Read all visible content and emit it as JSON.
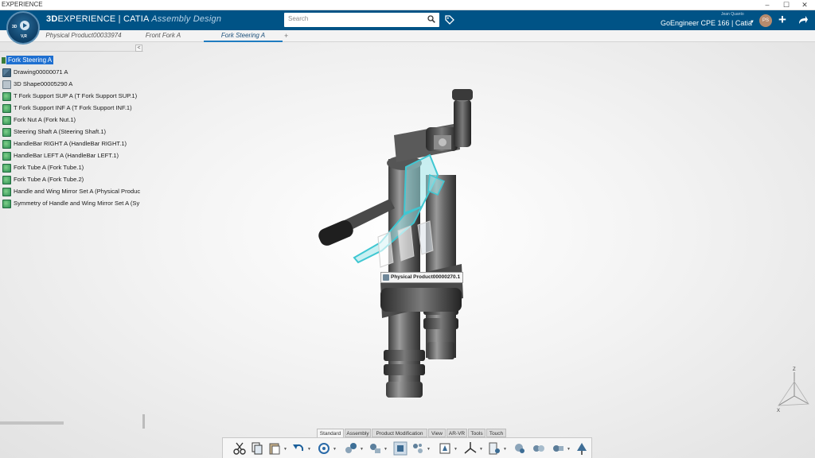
{
  "os": {
    "title": "EXPERIENCE",
    "minimize": "–",
    "maximize": "☐",
    "close": "✕"
  },
  "header": {
    "compass_3d": "3D",
    "compass_version": "V,R",
    "brand_strong": "3D",
    "brand_text": "EXPERIENCE | CATIA",
    "app_name": "Assembly Design",
    "search_placeholder": "Search",
    "user_name": "Jean Quanto",
    "tenant": "GoEngineer CPE 166 | Catia",
    "avatar_initials": "PS",
    "add_glyph": "+"
  },
  "tabs": [
    {
      "label": "Physical Product00033974"
    },
    {
      "label": "Front Fork A"
    },
    {
      "label": "Fork Steering A"
    }
  ],
  "tab_add": "+",
  "tree": {
    "collapse_glyph": "<",
    "root": "Fork Steering A",
    "items": [
      {
        "label": "Drawing00000071 A",
        "icon": "drawing-icon"
      },
      {
        "label": "3D Shape00005290 A",
        "icon": "shape-icon"
      },
      {
        "label": "T Fork Support SUP A (T Fork Support SUP.1)",
        "icon": "part-icon"
      },
      {
        "label": "T Fork Support INF A (T Fork Support INF.1)",
        "icon": "part-icon"
      },
      {
        "label": "Fork Nut A (Fork Nut.1)",
        "icon": "part-icon"
      },
      {
        "label": "Steering Shaft A (Steering Shaft.1)",
        "icon": "part-icon"
      },
      {
        "label": "HandleBar RIGHT A (HandleBar RIGHT.1)",
        "icon": "part-icon"
      },
      {
        "label": "HandleBar LEFT A (HandleBar LEFT.1)",
        "icon": "part-icon"
      },
      {
        "label": "Fork Tube A (Fork Tube.1)",
        "icon": "part-icon"
      },
      {
        "label": "Fork Tube A (Fork Tube.2)",
        "icon": "part-icon"
      },
      {
        "label": "Handle and Wing Mirror Set A (Physical Produc",
        "icon": "part-icon"
      },
      {
        "label": "Symmetry of Handle and Wing Mirror Set A (Sy",
        "icon": "part-icon"
      }
    ]
  },
  "viewport": {
    "selection_label": "Physical Product00000270.1",
    "axis_z": "Z",
    "axis_x": "X"
  },
  "action_bar": {
    "sections": [
      "Standard",
      "Assembly",
      "Product Modification",
      "View",
      "AR-VR",
      "Tools",
      "Touch"
    ],
    "active_section": "Standard",
    "tools": [
      "cut-icon",
      "copy-icon",
      "paste-icon",
      "undo-icon",
      "update-icon",
      "snap-icon",
      "engineering-connection-icon",
      "fix-icon",
      "explode-icon",
      "manipulate-icon",
      "compass-icon",
      "filter-icon",
      "measure-icon",
      "section-icon",
      "clash-icon",
      "publish-icon"
    ]
  },
  "colors": {
    "header_bg": "#005386",
    "selection_bg": "#1e6fd0",
    "highlight": "#58d4dc",
    "viewport_bg": "#f3f3f3"
  }
}
